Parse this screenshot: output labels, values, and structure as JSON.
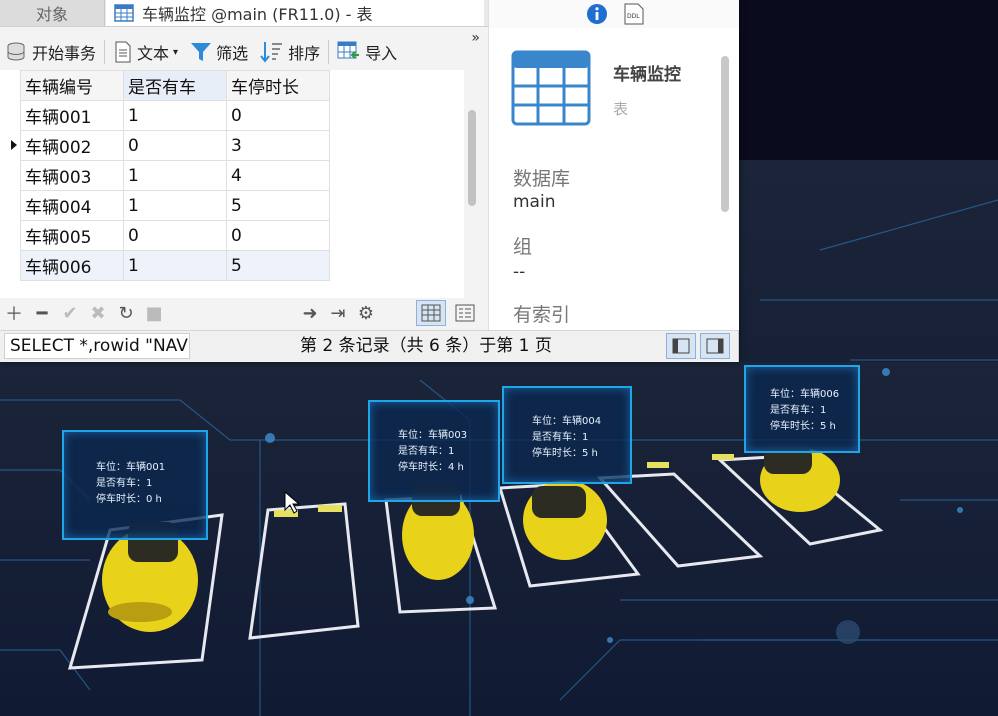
{
  "tabs": {
    "objects": "对象",
    "table_title": "车辆监控 @main (FR11.0) - 表"
  },
  "toolbar": {
    "begin_tx": "开始事务",
    "text": "文本",
    "filter": "筛选",
    "sort": "排序",
    "import": "导入",
    "more": "»"
  },
  "grid": {
    "columns": [
      "车辆编号",
      "是否有车",
      "车停时长"
    ],
    "rows": [
      [
        "车辆001",
        "1",
        "0"
      ],
      [
        "车辆002",
        "0",
        "3"
      ],
      [
        "车辆003",
        "1",
        "4"
      ],
      [
        "车辆004",
        "1",
        "5"
      ],
      [
        "车辆005",
        "0",
        "0"
      ],
      [
        "车辆006",
        "1",
        "5"
      ]
    ],
    "current_row": 1
  },
  "status": {
    "sql": "SELECT *,rowid \"NAV",
    "record": "第 2 条记录（共 6 条）于第 1 页"
  },
  "info_panel": {
    "title": "车辆监控",
    "subtitle": "表",
    "ddl_label": "DDL",
    "db_label": "数据库",
    "db_value": "main",
    "group_label": "组",
    "group_value": "--",
    "index_label": "有索引"
  },
  "cards": [
    {
      "l1": "车位：车辆001",
      "l2": "是否有车：1",
      "l3": "停车时长：0 h"
    },
    {
      "l1": "车位：车辆003",
      "l2": "是否有车：1",
      "l3": "停车时长：4 h"
    },
    {
      "l1": "车位：车辆004",
      "l2": "是否有车：1",
      "l3": "停车时长：5 h"
    },
    {
      "l1": "车位：车辆006",
      "l2": "是否有车：1",
      "l3": "停车时长：5 h"
    }
  ],
  "colors": {
    "accent": "#1fa6e8",
    "card_bg": "#0a2850",
    "car_yellow": "#f2d21b"
  }
}
